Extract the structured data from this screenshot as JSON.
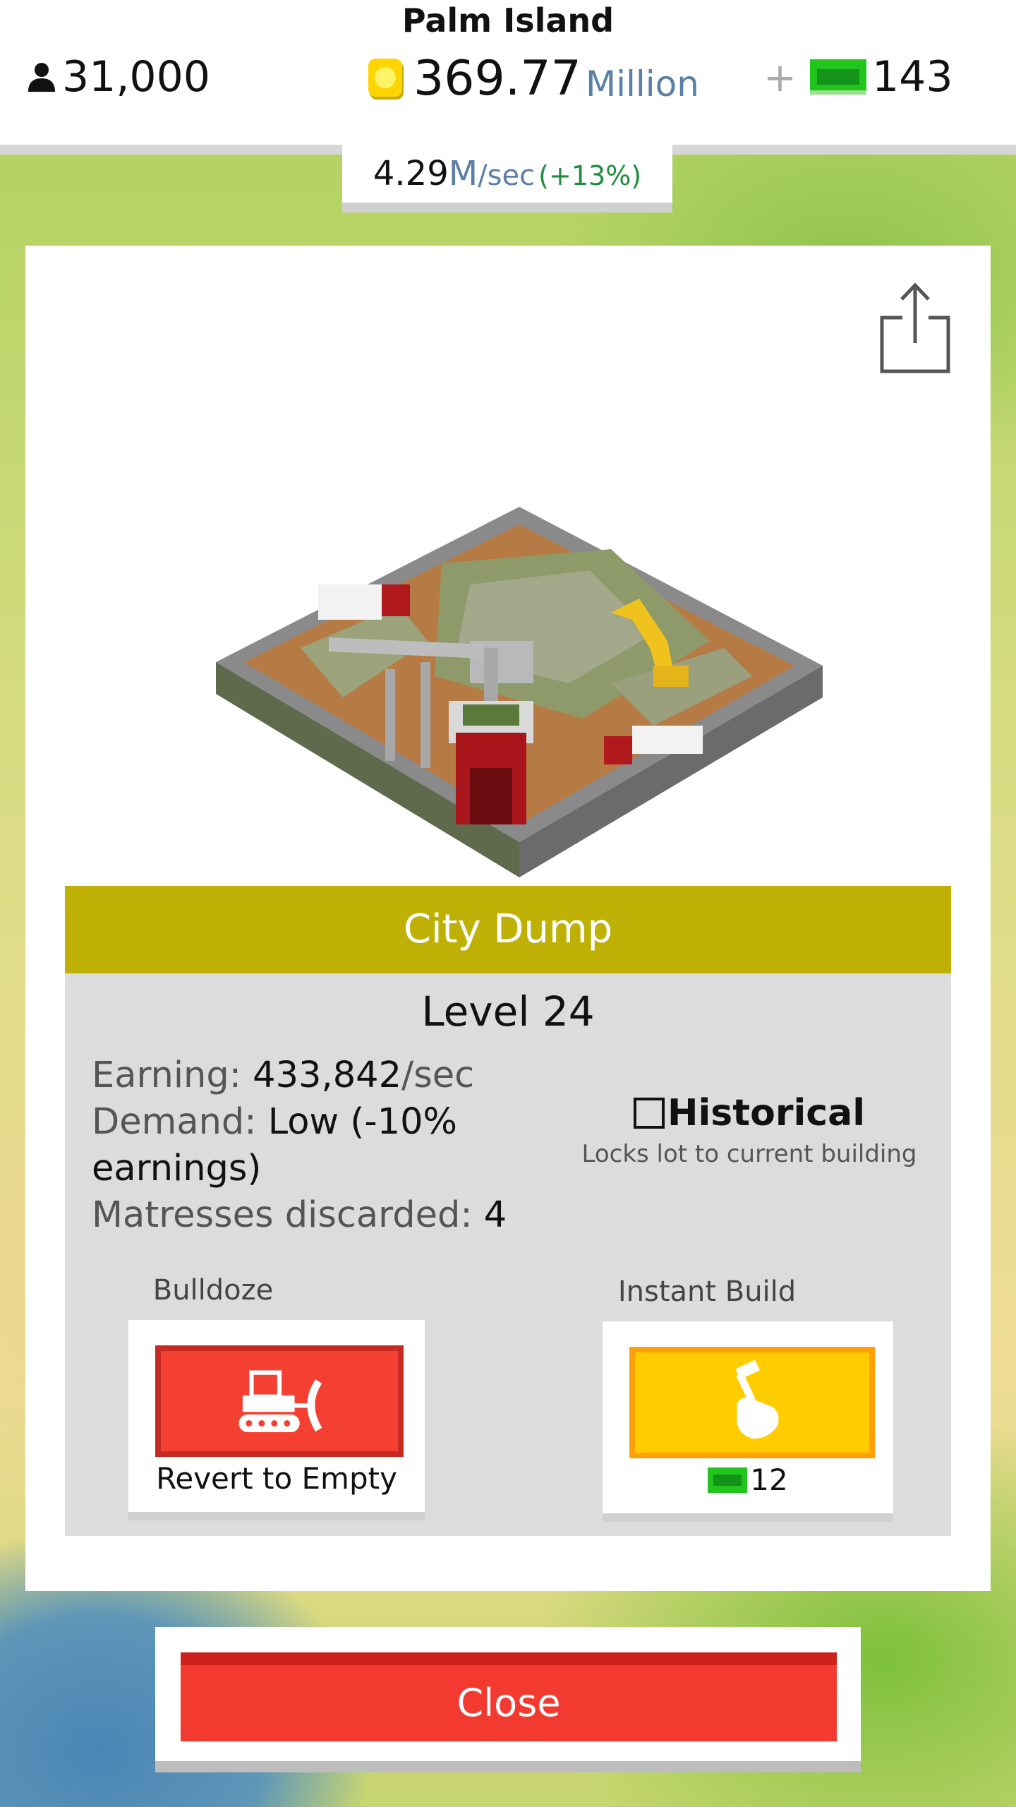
{
  "header": {
    "island_name": "Palm Island",
    "population": "31,000",
    "coins_value": "369.77",
    "coins_unit": "Million",
    "plus_label": "+",
    "cash_count": "143",
    "rate_value": "4.29",
    "rate_unit": "M",
    "rate_per": "/sec",
    "rate_bonus": "(+13%)"
  },
  "building": {
    "name": "City Dump",
    "level": "Level 24",
    "earning_label": "Earning:",
    "earning_value": "433,842",
    "earning_unit": "/sec",
    "demand_label": "Demand:",
    "demand_value": "Low (-10% earnings)",
    "stat_label": "Matresses discarded:",
    "stat_value": "4",
    "historical_label": "Historical",
    "historical_checked": false,
    "historical_sub": "Locks lot to current building"
  },
  "actions": {
    "bulldoze_title": "Bulldoze",
    "bulldoze_label": "Revert to Empty",
    "instant_title": "Instant Build",
    "instant_cost": "12"
  },
  "close_label": "Close",
  "colors": {
    "title_bar": "#bfb006",
    "cash_green": "#22c51d",
    "coin_gold": "#f5d90a",
    "red_button": "#f44032",
    "yellow_button": "#ffcc00"
  },
  "icons": [
    "person-icon",
    "coin-icon",
    "cash-icon",
    "share-icon",
    "bulldozer-icon",
    "hammer-hand-icon"
  ]
}
